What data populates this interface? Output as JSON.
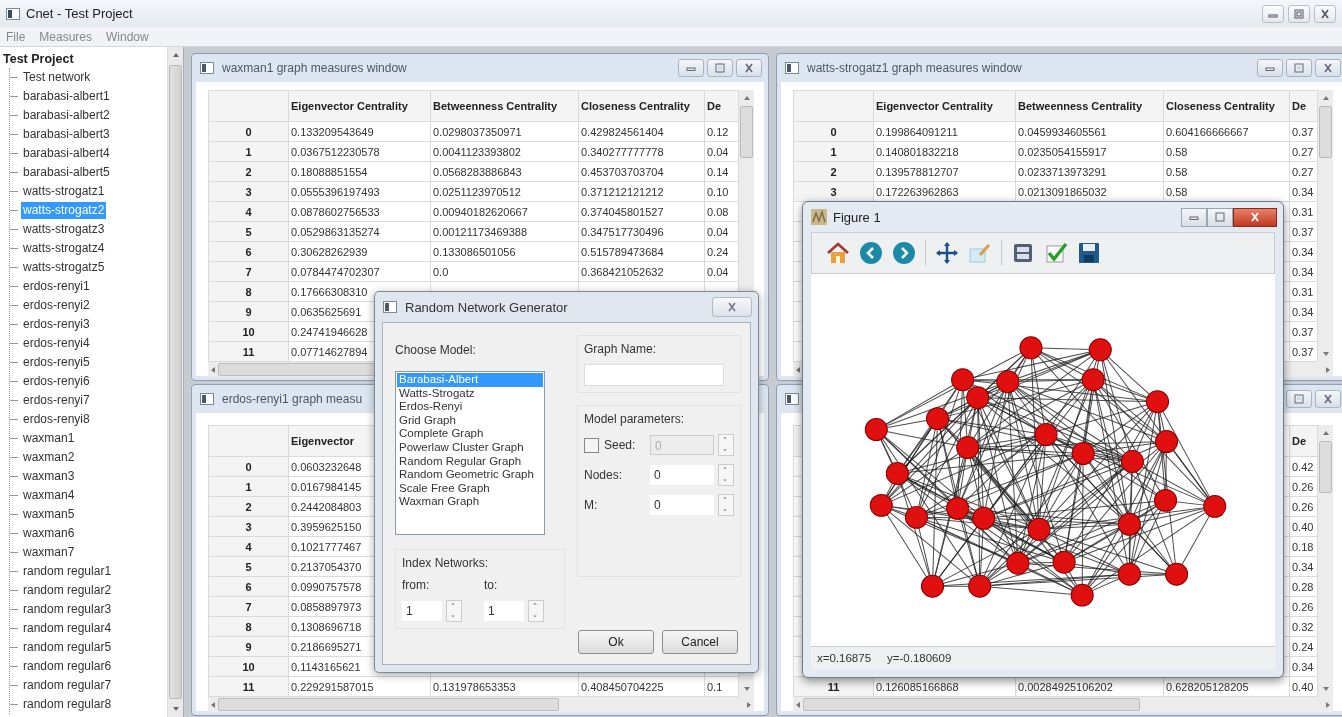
{
  "window": {
    "title": "Cnet - Test Project"
  },
  "menu": [
    "File",
    "Measures",
    "Window"
  ],
  "project_tree": {
    "label": "Test Project",
    "children": [
      {
        "label": "Test network",
        "selected": false
      },
      {
        "label": "barabasi-albert1",
        "selected": false
      },
      {
        "label": "barabasi-albert2",
        "selected": false
      },
      {
        "label": "barabasi-albert3",
        "selected": false
      },
      {
        "label": "barabasi-albert4",
        "selected": false
      },
      {
        "label": "barabasi-albert5",
        "selected": false
      },
      {
        "label": "watts-strogatz1",
        "selected": false
      },
      {
        "label": "watts-strogatz2",
        "selected": true
      },
      {
        "label": "watts-strogatz3",
        "selected": false
      },
      {
        "label": "watts-strogatz4",
        "selected": false
      },
      {
        "label": "watts-strogatz5",
        "selected": false
      },
      {
        "label": "erdos-renyi1",
        "selected": false
      },
      {
        "label": "erdos-renyi2",
        "selected": false
      },
      {
        "label": "erdos-renyi3",
        "selected": false
      },
      {
        "label": "erdos-renyi4",
        "selected": false
      },
      {
        "label": "erdos-renyi5",
        "selected": false
      },
      {
        "label": "erdos-renyi6",
        "selected": false
      },
      {
        "label": "erdos-renyi7",
        "selected": false
      },
      {
        "label": "erdos-renyi8",
        "selected": false
      },
      {
        "label": "waxman1",
        "selected": false
      },
      {
        "label": "waxman2",
        "selected": false
      },
      {
        "label": "waxman3",
        "selected": false
      },
      {
        "label": "waxman4",
        "selected": false
      },
      {
        "label": "waxman5",
        "selected": false
      },
      {
        "label": "waxman6",
        "selected": false
      },
      {
        "label": "waxman7",
        "selected": false
      },
      {
        "label": "random regular1",
        "selected": false
      },
      {
        "label": "random regular2",
        "selected": false
      },
      {
        "label": "random regular3",
        "selected": false
      },
      {
        "label": "random regular4",
        "selected": false
      },
      {
        "label": "random regular5",
        "selected": false
      },
      {
        "label": "random regular6",
        "selected": false
      },
      {
        "label": "random regular7",
        "selected": false
      },
      {
        "label": "random regular8",
        "selected": false
      }
    ]
  },
  "subwindows": [
    {
      "title": "waxman1 graph measures window",
      "columns": [
        "Eigenvector Centrality",
        "Betweenness Centrality",
        "Closeness Centrality",
        "De"
      ],
      "rows": [
        {
          "header": "0",
          "cells": [
            "0.133209543649",
            "0.0298037350971",
            "0.429824561404",
            "0.12"
          ]
        },
        {
          "header": "1",
          "cells": [
            "0.0367512230578",
            "0.0041123393802",
            "0.340277777778",
            "0.04"
          ]
        },
        {
          "header": "2",
          "cells": [
            "0.18088851554",
            "0.0568283886843",
            "0.453703703704",
            "0.14"
          ]
        },
        {
          "header": "3",
          "cells": [
            "0.0555396197493",
            "0.0251123970512",
            "0.371212121212",
            "0.10"
          ]
        },
        {
          "header": "4",
          "cells": [
            "0.0878602756533",
            "0.00940182620667",
            "0.374045801527",
            "0.08"
          ]
        },
        {
          "header": "5",
          "cells": [
            "0.0529863135274",
            "0.00121173469388",
            "0.347517730496",
            "0.04"
          ]
        },
        {
          "header": "6",
          "cells": [
            "0.30628262939",
            "0.133086501056",
            "0.515789473684",
            "0.24"
          ]
        },
        {
          "header": "7",
          "cells": [
            "0.0784474702307",
            "0.0",
            "0.368421052632",
            "0.04"
          ]
        },
        {
          "header": "8",
          "cells": [
            "0.17666308310"
          ]
        },
        {
          "header": "9",
          "cells": [
            "0.0635625691"
          ]
        },
        {
          "header": "10",
          "cells": [
            "0.24741946628"
          ]
        },
        {
          "header": "11",
          "cells": [
            "0.07714627894"
          ]
        }
      ]
    },
    {
      "title": "watts-strogatz1 graph measures window",
      "columns": [
        "Eigenvector Centrality",
        "Betweenness Centrality",
        "Closeness Centrality",
        "De"
      ],
      "rows": [
        {
          "header": "0",
          "cells": [
            "0.199864091211",
            "0.0459934605561",
            "0.604166666667",
            "0.37"
          ]
        },
        {
          "header": "1",
          "cells": [
            "0.140801832218",
            "0.0235054155917",
            "0.58",
            "0.27"
          ]
        },
        {
          "header": "2",
          "cells": [
            "0.139578812707",
            "0.0233713973291",
            "0.58",
            "0.27"
          ]
        },
        {
          "header": "3",
          "cells": [
            "0.172263962863",
            "0.0213091865032",
            "0.58",
            "0.34"
          ]
        },
        {
          "cells": [
            null,
            null,
            null,
            "0.31"
          ]
        },
        {
          "cells": [
            null,
            null,
            null,
            "0.37"
          ]
        },
        {
          "cells": [
            null,
            null,
            null,
            "0.34"
          ]
        },
        {
          "cells": [
            null,
            null,
            null,
            "0.34"
          ]
        },
        {
          "cells": [
            null,
            null,
            null,
            "0.31"
          ]
        },
        {
          "cells": [
            null,
            null,
            null,
            "0.34"
          ]
        },
        {
          "cells": [
            null,
            null,
            null,
            "0.37"
          ]
        },
        {
          "cells": [
            null,
            null,
            null,
            "0.37"
          ]
        }
      ]
    },
    {
      "title": "erdos-renyi1 graph measu",
      "columns": [
        "Eigenvector",
        null,
        null,
        null
      ],
      "rows": [
        {
          "header": "0",
          "cells": [
            "0.0603232648"
          ]
        },
        {
          "header": "1",
          "cells": [
            "0.0167984145"
          ]
        },
        {
          "header": "2",
          "cells": [
            "0.2442084803"
          ]
        },
        {
          "header": "3",
          "cells": [
            "0.3959625150"
          ]
        },
        {
          "header": "4",
          "cells": [
            "0.1021777467"
          ]
        },
        {
          "header": "5",
          "cells": [
            "0.2137054370"
          ]
        },
        {
          "header": "6",
          "cells": [
            "0.0990757578"
          ]
        },
        {
          "header": "7",
          "cells": [
            "0.0858897973"
          ]
        },
        {
          "header": "8",
          "cells": [
            "0.1308696718"
          ]
        },
        {
          "header": "9",
          "cells": [
            "0.2186695271"
          ]
        },
        {
          "header": "10",
          "cells": [
            "0.1143165621"
          ]
        },
        {
          "header": "11",
          "cells": [
            "0.229291587015",
            "0.131978653353",
            "0.408450704225",
            "0.1"
          ]
        }
      ]
    },
    {
      "columns": [
        null,
        null,
        null,
        "De"
      ],
      "rows": [
        {
          "cells": [
            null,
            null,
            null,
            "0.42"
          ]
        },
        {
          "cells": [
            null,
            null,
            null,
            "0.26"
          ]
        },
        {
          "cells": [
            null,
            null,
            null,
            "0.26"
          ]
        },
        {
          "cells": [
            null,
            null,
            null,
            "0.40"
          ]
        },
        {
          "cells": [
            null,
            null,
            null,
            "0.18"
          ]
        },
        {
          "cells": [
            null,
            null,
            null,
            "0.34"
          ]
        },
        {
          "cells": [
            null,
            null,
            null,
            "0.28"
          ]
        },
        {
          "cells": [
            null,
            null,
            null,
            "0.26"
          ]
        },
        {
          "cells": [
            null,
            null,
            null,
            "0.32"
          ]
        },
        {
          "cells": [
            null,
            null,
            null,
            "0.24"
          ]
        },
        {
          "cells": [
            null,
            null,
            null,
            "0.34"
          ]
        },
        {
          "header": "11",
          "cells": [
            "0.126085166868",
            "0.00284925106202",
            "0.628205128205",
            "0.40"
          ]
        }
      ]
    }
  ],
  "dialog": {
    "title": "Random Network Generator",
    "model_label": "Choose Model:",
    "models": [
      {
        "label": "Barabasi-Albert",
        "selected": true
      },
      {
        "label": "Watts-Strogatz",
        "selected": false
      },
      {
        "label": "Erdos-Renyi",
        "selected": false
      },
      {
        "label": "Grid Graph",
        "selected": false
      },
      {
        "label": "Complete Graph",
        "selected": false
      },
      {
        "label": "Powerlaw Cluster Graph",
        "selected": false
      },
      {
        "label": "Random Regular Graph",
        "selected": false
      },
      {
        "label": "Random Geometric Graph",
        "selected": false
      },
      {
        "label": "Scale Free Graph",
        "selected": false
      },
      {
        "label": "Waxman Graph",
        "selected": false
      }
    ],
    "index_networks": {
      "label": "Index Networks:",
      "fields": [
        {
          "label": "from:",
          "value": "1"
        },
        {
          "label": "to:",
          "value": "1"
        }
      ]
    },
    "graph_name": {
      "label": "Graph Name:"
    },
    "model_parameters": {
      "label": "Model parameters:",
      "fields": [
        {
          "kind": "checkbox",
          "label": "Seed:",
          "checked": false,
          "value": "0",
          "disabled": true
        },
        {
          "kind": "plain",
          "label": "Nodes:",
          "value": "0",
          "disabled": false
        },
        {
          "kind": "plain",
          "label": "M:",
          "value": "0",
          "disabled": false
        }
      ]
    },
    "buttons": [
      "Ok",
      "Cancel"
    ]
  },
  "figure": {
    "title": "Figure 1",
    "status": [
      "x=0.16875",
      "y=-0.180609"
    ]
  }
}
